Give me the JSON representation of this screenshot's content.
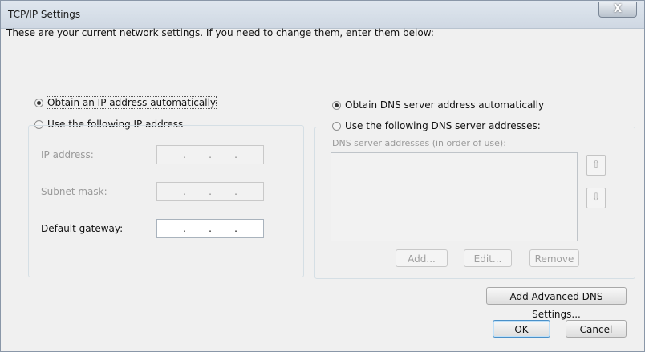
{
  "window": {
    "title": "TCP/IP Settings",
    "close_label": "X"
  },
  "intro": "These are your current network settings.  If you need to change them, enter them below:",
  "ip": {
    "auto_label": "Obtain an IP address automatically",
    "manual_label": "Use the following IP address",
    "selected": "auto",
    "fields": [
      {
        "label": "IP address:",
        "value": ". . .",
        "enabled": false
      },
      {
        "label": "Subnet mask:",
        "value": ". . .",
        "enabled": false
      },
      {
        "label": "Default gateway:",
        "value": ". . .",
        "enabled": true
      }
    ]
  },
  "dns": {
    "auto_label": "Obtain DNS server address automatically",
    "manual_label": "Use the following DNS server addresses:",
    "selected": "auto",
    "list_label": "DNS server addresses (in order of use):",
    "up_icon": "arrow-up-icon",
    "down_icon": "arrow-down-icon",
    "up_glyph": "⇧",
    "down_glyph": "⇩",
    "add_label": "Add...",
    "edit_label": "Edit...",
    "remove_label": "Remove"
  },
  "buttons": {
    "advanced_label": "Add Advanced DNS Settings...",
    "ok_label": "OK",
    "cancel_label": "Cancel"
  }
}
